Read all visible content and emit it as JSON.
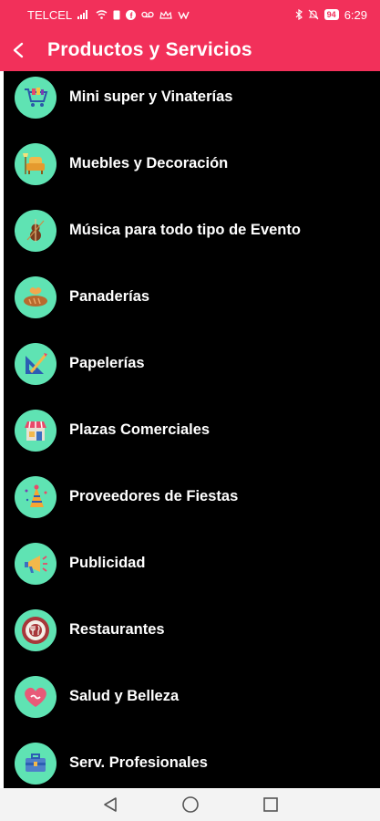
{
  "status_bar": {
    "carrier": "TELCEL",
    "battery": "94",
    "time": "6:29",
    "icons": [
      "signal-icon",
      "wifi-icon",
      "sim-icon",
      "facebook-icon",
      "voicemail-icon",
      "crown-icon",
      "notification-icon",
      "bluetooth-icon",
      "mute-icon",
      "battery-icon"
    ]
  },
  "header": {
    "title": "Productos y Servicios",
    "back_icon": "back-arrow-icon"
  },
  "categories": [
    {
      "label": "Mini super y Vinaterías",
      "icon": "shopping-cart-icon"
    },
    {
      "label": "Muebles y Decoración",
      "icon": "armchair-icon"
    },
    {
      "label": "Música para todo tipo de Evento",
      "icon": "violin-icon"
    },
    {
      "label": "Panaderías",
      "icon": "bread-icon"
    },
    {
      "label": "Papelerías",
      "icon": "stationery-icon"
    },
    {
      "label": "Plazas Comerciales",
      "icon": "storefront-icon"
    },
    {
      "label": "Proveedores de Fiestas",
      "icon": "party-hat-icon"
    },
    {
      "label": "Publicidad",
      "icon": "megaphone-icon"
    },
    {
      "label": "Restaurantes",
      "icon": "restaurant-icon"
    },
    {
      "label": "Salud y Belleza",
      "icon": "heart-icon"
    },
    {
      "label": "Serv. Profesionales",
      "icon": "briefcase-icon"
    }
  ],
  "nav_bar": {
    "icons": [
      "nav-back-icon",
      "nav-home-icon",
      "nav-recents-icon"
    ]
  },
  "colors": {
    "header": "#f2305a",
    "list_background": "#000000",
    "icon_circle": "#5fe3b3",
    "nav_bar": "#f3f3f3"
  }
}
